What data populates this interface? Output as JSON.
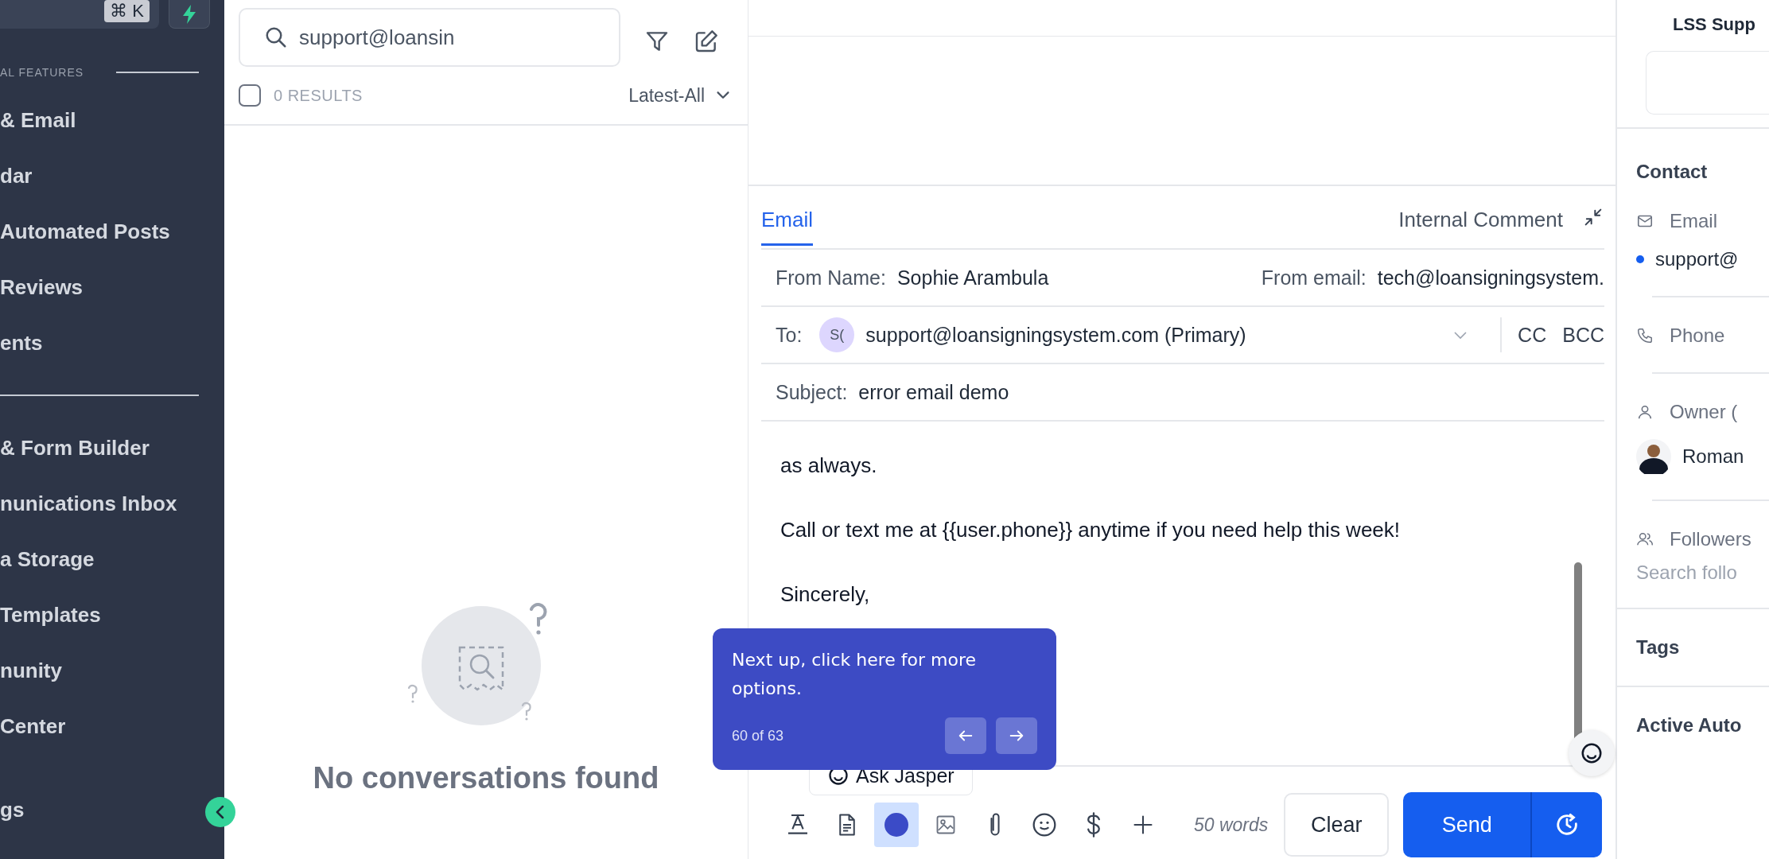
{
  "sidebar": {
    "search_shortcut": "⌘ K",
    "section_label": "AL FEATURES",
    "groups": [
      {
        "items": [
          {
            "label": "& Email"
          },
          {
            "label": "dar"
          },
          {
            "label": "Automated Posts"
          },
          {
            "label": "Reviews"
          },
          {
            "label": "ents"
          }
        ]
      },
      {
        "items": [
          {
            "label": "& Form Builder"
          },
          {
            "label": "nunications Inbox"
          },
          {
            "label": "a Storage"
          },
          {
            "label": "Templates"
          },
          {
            "label": "nunity"
          },
          {
            "label": "Center"
          }
        ]
      },
      {
        "items": [
          {
            "label": "gs"
          }
        ]
      }
    ]
  },
  "conversations": {
    "search_value": "support@loansin",
    "select_all_checked": false,
    "results": "0 RESULTS",
    "sort": "Latest-All",
    "empty_message": "No conversations found"
  },
  "composer": {
    "tabs": [
      {
        "label": "Email",
        "selected": true
      },
      {
        "label": "Internal Comment",
        "selected": false
      }
    ],
    "from_name_label": "From Name:",
    "from_name": "Sophie Arambula",
    "from_email_label": "From email:",
    "from_email": "tech@loansigningsystem.",
    "to_label": "To:",
    "to_initials": "S(",
    "to_value": "support@loansigningsystem.com (Primary)",
    "cc": "CC",
    "bcc": "BCC",
    "subject_label": "Subject:",
    "subject": "error email demo",
    "body": [
      "as always.",
      "Call or text me at {{user.phone}} anytime if you need help this week!",
      "Sincerely,"
    ],
    "ask_button": "Ask Jasper",
    "tools": [
      {
        "kind": "format",
        "selected": false
      },
      {
        "kind": "template",
        "selected": false
      },
      {
        "kind": "dot",
        "selected": true
      },
      {
        "kind": "image",
        "selected": false
      },
      {
        "kind": "attach",
        "selected": false
      },
      {
        "kind": "emoji",
        "selected": false
      },
      {
        "kind": "dollar",
        "selected": false
      },
      {
        "kind": "plus",
        "selected": false
      }
    ],
    "word_count": "50 words",
    "clear": "Clear",
    "send": "Send"
  },
  "tour": {
    "text": "Next up, click here for more options.",
    "step": "60 of 63"
  },
  "contact_panel": {
    "title": "LSS Supp",
    "heading": "Contact",
    "email_label": "Email",
    "email_value": "support@",
    "phone_label": "Phone",
    "owner_label": "Owner (",
    "owner_name": "Roman",
    "followers_label": "Followers",
    "followers_placeholder": "Search follo",
    "tags": "Tags",
    "automations": "Active Auto"
  }
}
